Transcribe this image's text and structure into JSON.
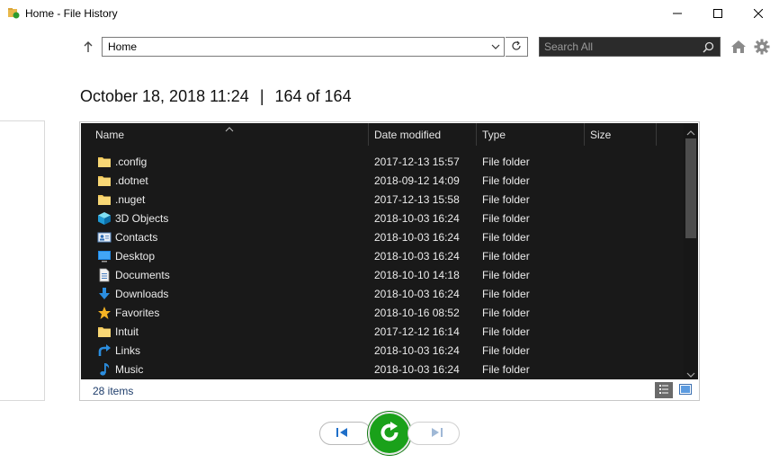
{
  "window": {
    "title": "Home - File History"
  },
  "toolbar": {
    "address": "Home",
    "search_placeholder": "Search All"
  },
  "header": {
    "date": "October 18, 2018 11:24",
    "separator": "|",
    "position": "164 of 164"
  },
  "columns": {
    "name": "Name",
    "date": "Date modified",
    "type": "Type",
    "size": "Size"
  },
  "files": [
    {
      "name": ".config",
      "date": "2017-12-13 15:57",
      "type": "File folder",
      "icon": "folder-icon"
    },
    {
      "name": ".dotnet",
      "date": "2018-09-12 14:09",
      "type": "File folder",
      "icon": "folder-icon"
    },
    {
      "name": ".nuget",
      "date": "2017-12-13 15:58",
      "type": "File folder",
      "icon": "folder-icon"
    },
    {
      "name": "3D Objects",
      "date": "2018-10-03 16:24",
      "type": "File folder",
      "icon": "3d-objects-icon"
    },
    {
      "name": "Contacts",
      "date": "2018-10-03 16:24",
      "type": "File folder",
      "icon": "contacts-icon"
    },
    {
      "name": "Desktop",
      "date": "2018-10-03 16:24",
      "type": "File folder",
      "icon": "desktop-icon"
    },
    {
      "name": "Documents",
      "date": "2018-10-10 14:18",
      "type": "File folder",
      "icon": "documents-icon"
    },
    {
      "name": "Downloads",
      "date": "2018-10-03 16:24",
      "type": "File folder",
      "icon": "downloads-icon"
    },
    {
      "name": "Favorites",
      "date": "2018-10-16 08:52",
      "type": "File folder",
      "icon": "favorites-icon"
    },
    {
      "name": "Intuit",
      "date": "2017-12-12 16:14",
      "type": "File folder",
      "icon": "folder-icon"
    },
    {
      "name": "Links",
      "date": "2018-10-03 16:24",
      "type": "File folder",
      "icon": "links-icon"
    },
    {
      "name": "Music",
      "date": "2018-10-03 16:24",
      "type": "File folder",
      "icon": "music-icon"
    }
  ],
  "status": {
    "item_count": "28 items"
  },
  "colors": {
    "list_background": "#191919",
    "restore_green": "#1aa11a",
    "folder_yellow": "#f3c95a"
  }
}
